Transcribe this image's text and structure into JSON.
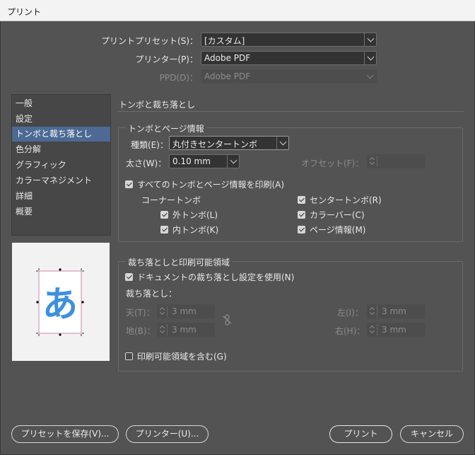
{
  "window": {
    "title": "プリント"
  },
  "top": {
    "preset_label": "プリントプリセット(S)：",
    "preset_value": "[カスタム]",
    "printer_label": "プリンター(P)：",
    "printer_value": "Adobe PDF",
    "ppd_label": "PPD(D)：",
    "ppd_value": "Adobe PDF"
  },
  "sidebar": {
    "items": [
      {
        "label": "一般"
      },
      {
        "label": "設定"
      },
      {
        "label": "トンボと裁ち落とし"
      },
      {
        "label": "色分解"
      },
      {
        "label": "グラフィック"
      },
      {
        "label": "カラーマネジメント"
      },
      {
        "label": "詳細"
      },
      {
        "label": "概要"
      }
    ],
    "selected_index": 2
  },
  "preview": {
    "glyph": "あ"
  },
  "panel": {
    "title": "トンボと裁ち落とし",
    "marks": {
      "title": "トンボとページ情報",
      "type_label": "種類(E)：",
      "type_value": "丸付きセンタートンボ",
      "weight_label": "太さ(W)：",
      "weight_value": "0.10 mm",
      "offset_label": "オフセット(F)：",
      "offset_value": "",
      "print_all_label": "すべてのトンボとページ情報を印刷(A)",
      "corner_label": "コーナートンボ",
      "outer_label": "外トンボ(L)",
      "inner_label": "内トンボ(K)",
      "center_label": "センタートンボ(R)",
      "colorbar_label": "カラーバー(C)",
      "pageinfo_label": "ページ情報(M)",
      "checked": {
        "print_all": true,
        "outer": true,
        "inner": true,
        "center": true,
        "colorbar": true,
        "pageinfo": true
      }
    },
    "bleed": {
      "title": "裁ち落としと印刷可能領域",
      "use_doc_label": "ドキュメントの裁ち落とし設定を使用(N)",
      "bleed_label": "裁ち落とし：",
      "top_label": "天(T)：",
      "top_value": "3 mm",
      "bottom_label": "地(B)：",
      "bottom_value": "3 mm",
      "left_label": "左(I)：",
      "left_value": "3 mm",
      "right_label": "右(H)：",
      "right_value": "3 mm",
      "include_slug_label": "印刷可能領域を含む(G)",
      "checked": {
        "use_doc": true,
        "include_slug": false
      }
    }
  },
  "footer": {
    "save_preset": "プリセットを保存(V)...",
    "printer": "プリンター(U)...",
    "print": "プリント",
    "cancel": "キャンセル"
  },
  "colors": {
    "accent_selection": "#4c6a93",
    "preview_glyph": "#3d8fe0",
    "background": "#535353"
  }
}
